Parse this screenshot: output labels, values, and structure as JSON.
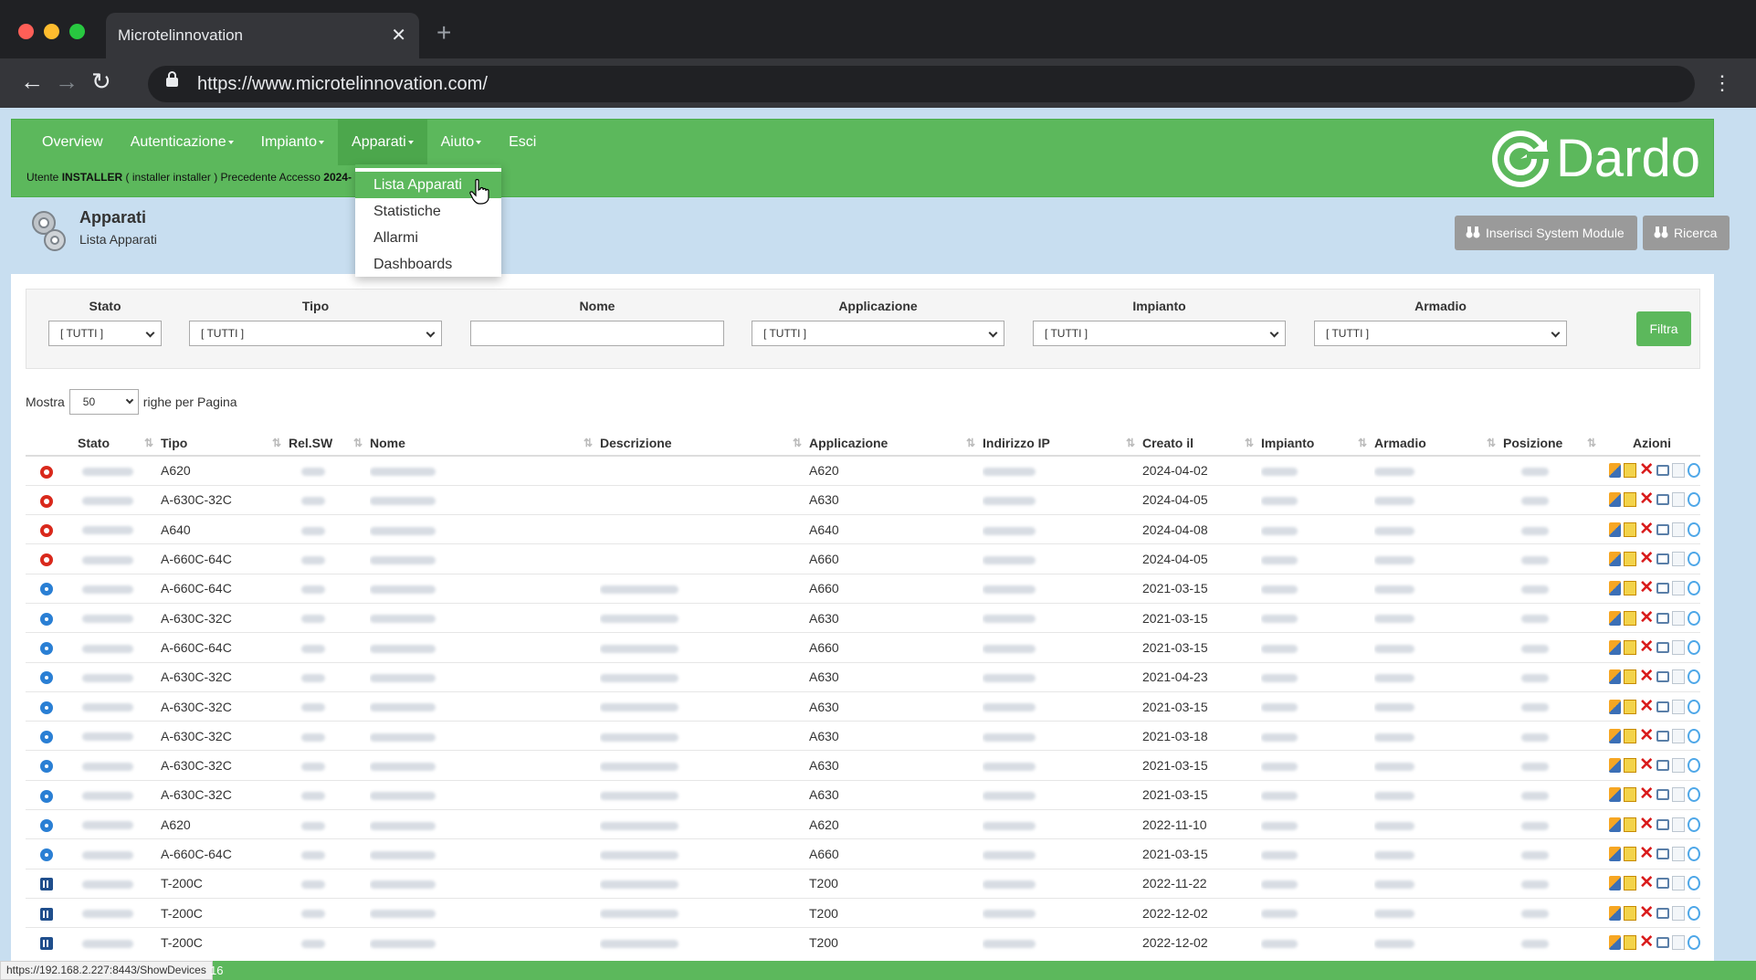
{
  "browser": {
    "tab_title": "Microtelinnovation",
    "tab_close": "✕",
    "new_tab": "+",
    "url": "https://www.microtelinnovation.com/"
  },
  "nav": {
    "items": [
      {
        "label": "Overview",
        "caret": false
      },
      {
        "label": "Autenticazione",
        "caret": true
      },
      {
        "label": "Impianto",
        "caret": true
      },
      {
        "label": "Apparati",
        "caret": true,
        "active": true
      },
      {
        "label": "Aiuto",
        "caret": true
      },
      {
        "label": "Esci",
        "caret": false
      }
    ],
    "user_prefix": "Utente",
    "user_name": "INSTALLER",
    "user_rest": "( installer installer ) Precedente Accesso",
    "user_date": "2024-"
  },
  "logo": {
    "text": "Dardo"
  },
  "dropdown": {
    "items": [
      "Lista Apparati",
      "Statistiche",
      "Allarmi",
      "Dashboards"
    ]
  },
  "page": {
    "title": "Apparati",
    "subtitle": "Lista Apparati",
    "btn_insert": "Inserisci System Module",
    "btn_search": "Ricerca"
  },
  "filters": {
    "stato": {
      "label": "Stato",
      "value": "[ TUTTI ]"
    },
    "tipo": {
      "label": "Tipo",
      "value": "[ TUTTI ]"
    },
    "nome": {
      "label": "Nome",
      "value": ""
    },
    "applicazione": {
      "label": "Applicazione",
      "value": "[ TUTTI ]"
    },
    "impianto": {
      "label": "Impianto",
      "value": "[ TUTTI ]"
    },
    "armadio": {
      "label": "Armadio",
      "value": "[ TUTTI ]"
    },
    "button": "Filtra"
  },
  "paging": {
    "prefix": "Mostra",
    "value": "50",
    "suffix": "righe per Pagina"
  },
  "table": {
    "columns": [
      "Stato",
      "Tipo",
      "Rel.SW",
      "Nome",
      "Descrizione",
      "Applicazione",
      "Indirizzo IP",
      "Creato il",
      "Impianto",
      "Armadio",
      "Posizione",
      "Azioni"
    ],
    "rows": [
      {
        "icon": "red",
        "tipo": "A620",
        "app": "A620",
        "created": "2024-04-02",
        "desc": false
      },
      {
        "icon": "red",
        "tipo": "A-630C-32C",
        "app": "A630",
        "created": "2024-04-05",
        "desc": false
      },
      {
        "icon": "red",
        "tipo": "A640",
        "app": "A640",
        "created": "2024-04-08",
        "desc": false
      },
      {
        "icon": "red",
        "tipo": "A-660C-64C",
        "app": "A660",
        "created": "2024-04-05",
        "desc": false
      },
      {
        "icon": "blue",
        "tipo": "A-660C-64C",
        "app": "A660",
        "created": "2021-03-15",
        "desc": true
      },
      {
        "icon": "blue",
        "tipo": "A-630C-32C",
        "app": "A630",
        "created": "2021-03-15",
        "desc": true
      },
      {
        "icon": "blue",
        "tipo": "A-660C-64C",
        "app": "A660",
        "created": "2021-03-15",
        "desc": true
      },
      {
        "icon": "blue",
        "tipo": "A-630C-32C",
        "app": "A630",
        "created": "2021-04-23",
        "desc": true
      },
      {
        "icon": "blue",
        "tipo": "A-630C-32C",
        "app": "A630",
        "created": "2021-03-15",
        "desc": true
      },
      {
        "icon": "blue",
        "tipo": "A-630C-32C",
        "app": "A630",
        "created": "2021-03-18",
        "desc": true
      },
      {
        "icon": "blue",
        "tipo": "A-630C-32C",
        "app": "A630",
        "created": "2021-03-15",
        "desc": true
      },
      {
        "icon": "blue",
        "tipo": "A-630C-32C",
        "app": "A630",
        "created": "2021-03-15",
        "desc": true
      },
      {
        "icon": "blue",
        "tipo": "A620",
        "app": "A620",
        "created": "2022-11-10",
        "desc": true
      },
      {
        "icon": "blue",
        "tipo": "A-660C-64C",
        "app": "A660",
        "created": "2021-03-15",
        "desc": true
      },
      {
        "icon": "grid",
        "tipo": "T-200C",
        "app": "T200",
        "created": "2022-11-22",
        "desc": true
      },
      {
        "icon": "grid",
        "tipo": "T-200C",
        "app": "T200",
        "created": "2022-12-02",
        "desc": true
      },
      {
        "icon": "grid",
        "tipo": "T-200C",
        "app": "T200",
        "created": "2022-12-02",
        "desc": true
      }
    ]
  },
  "status": {
    "url": "https://192.168.2.227:8443/ShowDevices",
    "num": "16"
  },
  "colors": {
    "brand_green": "#5cb85c",
    "page_bg": "#c8def0"
  }
}
